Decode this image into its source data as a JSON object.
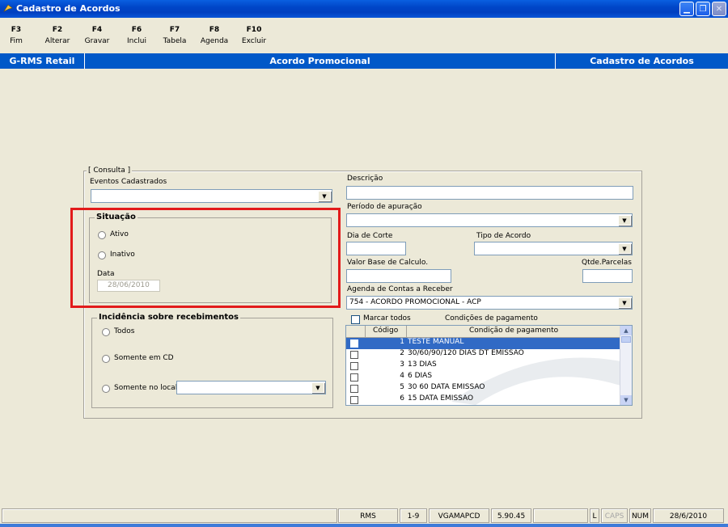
{
  "window": {
    "title": "Cadastro de Acordos"
  },
  "toolbar": [
    {
      "key": "F3",
      "label": "Fim"
    },
    {
      "key": "F2",
      "label": "Alterar"
    },
    {
      "key": "F4",
      "label": "Gravar"
    },
    {
      "key": "F6",
      "label": "Inclui"
    },
    {
      "key": "F7",
      "label": "Tabela"
    },
    {
      "key": "F8",
      "label": "Agenda"
    },
    {
      "key": "F10",
      "label": "Excluir"
    }
  ],
  "header": {
    "left": "G-RMS Retail",
    "center": "Acordo Promocional",
    "right": "Cadastro de Acordos"
  },
  "form": {
    "group_title": "[ Consulta ]",
    "eventos_label": "Eventos Cadastrados",
    "eventos_value": "",
    "situacao": {
      "title": "Situação",
      "ativo": "Ativo",
      "inativo": "Inativo",
      "data_label": "Data",
      "data_value": "28/06/2010"
    },
    "incidencia": {
      "title": "Incidência sobre recebimentos",
      "todos": "Todos",
      "somente_cd": "Somente em CD",
      "somente_local": "Somente no local",
      "local_value": ""
    },
    "descricao_label": "Descrição",
    "descricao_value": "",
    "periodo_label": "Período de apuração",
    "periodo_value": "",
    "dia_corte_label": "Dia de Corte",
    "dia_corte_value": "",
    "tipo_acordo_label": "Tipo de Acordo",
    "tipo_acordo_value": "",
    "valor_base_label": "Valor Base de Calculo.",
    "valor_base_value": "",
    "qtde_parcelas_label": "Qtde.Parcelas",
    "qtde_parcelas_value": "",
    "agenda_label": "Agenda de Contas a Receber",
    "agenda_value": "754 - ACORDO PROMOCIONAL - ACP",
    "marcar_todos": "Marcar todos",
    "condicoes_title": "Condições de pagamento",
    "grid_headers": {
      "code": "Código",
      "desc": "Condição de pagamento"
    },
    "grid_rows": [
      {
        "code": "1",
        "desc": "TESTE MANUAL"
      },
      {
        "code": "2",
        "desc": "30/60/90/120 DIAS DT EMISSAO"
      },
      {
        "code": "3",
        "desc": "13 DIAS"
      },
      {
        "code": "4",
        "desc": "6 DIAS"
      },
      {
        "code": "5",
        "desc": "30 60 DATA EMISSAO"
      },
      {
        "code": "6",
        "desc": "15 DATA EMISSAO"
      }
    ]
  },
  "status": [
    "RMS",
    "1-9",
    "VGAMAPCD",
    "5.90.45",
    "L",
    "CAPS",
    "NUM",
    "28/6/2010"
  ]
}
